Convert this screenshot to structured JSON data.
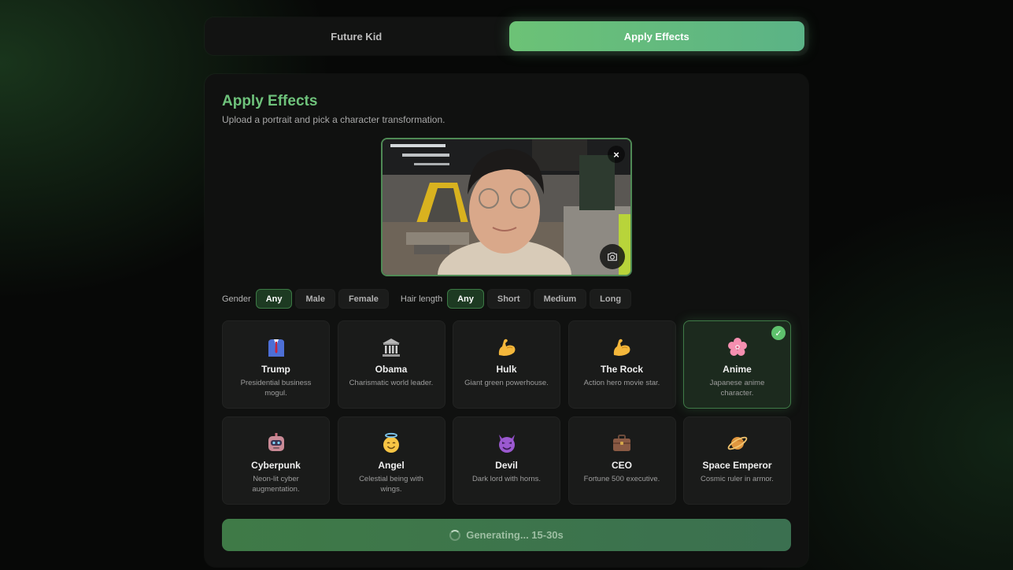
{
  "tabs": [
    {
      "label": "Future Kid",
      "active": false
    },
    {
      "label": "Apply Effects",
      "active": true
    }
  ],
  "panel": {
    "title": "Apply Effects",
    "subtitle": "Upload a portrait and pick a character transformation."
  },
  "photo": {
    "close_label": "×"
  },
  "filters": {
    "gender": {
      "label": "Gender",
      "options": [
        "Any",
        "Male",
        "Female"
      ],
      "selected": "Any"
    },
    "hair": {
      "label": "Hair length",
      "options": [
        "Any",
        "Short",
        "Medium",
        "Long"
      ],
      "selected": "Any"
    }
  },
  "effects": [
    {
      "name": "Trump",
      "desc": "Presidential business mogul.",
      "icon": "suit-icon"
    },
    {
      "name": "Obama",
      "desc": "Charismatic world leader.",
      "icon": "classical-building-icon"
    },
    {
      "name": "Hulk",
      "desc": "Giant green powerhouse.",
      "icon": "flexed-biceps-icon"
    },
    {
      "name": "The Rock",
      "desc": "Action hero movie star.",
      "icon": "flexed-biceps-icon"
    },
    {
      "name": "Anime",
      "desc": "Japanese anime character.",
      "icon": "cherry-blossom-icon",
      "selected": true
    },
    {
      "name": "Cyberpunk",
      "desc": "Neon-lit cyber augmentation.",
      "icon": "robot-icon"
    },
    {
      "name": "Angel",
      "desc": "Celestial being with wings.",
      "icon": "halo-face-icon"
    },
    {
      "name": "Devil",
      "desc": "Dark lord with horns.",
      "icon": "devil-face-icon"
    },
    {
      "name": "CEO",
      "desc": "Fortune 500 executive.",
      "icon": "briefcase-icon"
    },
    {
      "name": "Space Emperor",
      "desc": "Cosmic ruler in armor.",
      "icon": "ringed-planet-icon"
    }
  ],
  "selected_check": "✓",
  "generate": {
    "label": "Generating... 15-30s"
  },
  "colors": {
    "accent": "#6ec27b",
    "background": "#070807",
    "card": "#101110"
  }
}
